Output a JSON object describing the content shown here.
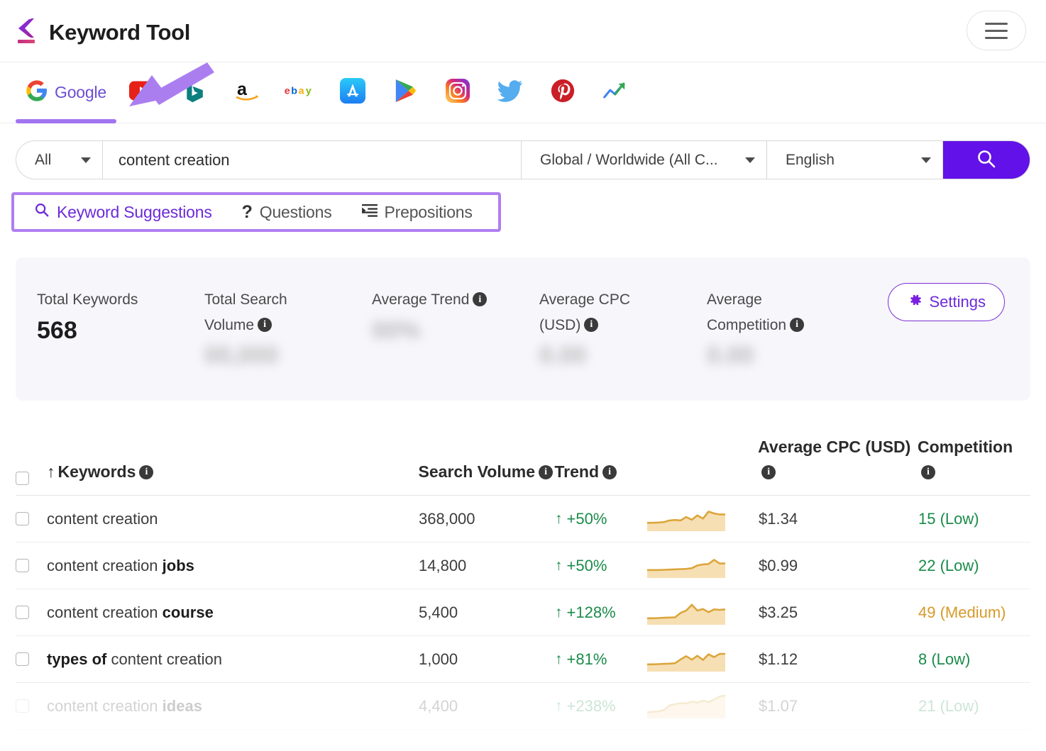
{
  "header": {
    "title": "Keyword Tool",
    "menu_icon": "hamburger-icon"
  },
  "platforms": [
    {
      "id": "google",
      "label": "Google",
      "icon": "google-icon",
      "active": true
    },
    {
      "id": "youtube",
      "label": "",
      "icon": "youtube-icon",
      "active": false
    },
    {
      "id": "bing",
      "label": "",
      "icon": "bing-icon",
      "active": false
    },
    {
      "id": "amazon",
      "label": "",
      "icon": "amazon-icon",
      "active": false
    },
    {
      "id": "ebay",
      "label": "",
      "icon": "ebay-icon",
      "active": false
    },
    {
      "id": "appstore",
      "label": "",
      "icon": "app-store-icon",
      "active": false
    },
    {
      "id": "playstore",
      "label": "",
      "icon": "play-store-icon",
      "active": false
    },
    {
      "id": "instagram",
      "label": "",
      "icon": "instagram-icon",
      "active": false
    },
    {
      "id": "twitter",
      "label": "",
      "icon": "twitter-icon",
      "active": false
    },
    {
      "id": "pinterest",
      "label": "",
      "icon": "pinterest-icon",
      "active": false
    },
    {
      "id": "trends",
      "label": "",
      "icon": "google-trends-icon",
      "active": false
    }
  ],
  "search": {
    "scope_value": "All",
    "query_value": "content creation",
    "query_placeholder": "content creation",
    "location_value": "Global / Worldwide (All C...",
    "language_value": "English",
    "search_icon": "search-icon"
  },
  "subtabs": [
    {
      "id": "keyword-suggestions",
      "label": "Keyword Suggestions",
      "icon": "magnifier-icon",
      "active": true
    },
    {
      "id": "questions",
      "label": "Questions",
      "icon": "question-mark-icon",
      "active": false
    },
    {
      "id": "prepositions",
      "label": "Prepositions",
      "icon": "list-indent-icon",
      "active": false
    }
  ],
  "stats": {
    "items": [
      {
        "label": "Total Keywords",
        "value": "568",
        "blurred": false,
        "has_info": false
      },
      {
        "label": "Total Search Volume",
        "value": "00,000",
        "blurred": true,
        "has_info": true
      },
      {
        "label": "Average Trend",
        "value": "00%",
        "blurred": true,
        "has_info": true
      },
      {
        "label": "Average CPC (USD)",
        "value": "0.00",
        "blurred": true,
        "has_info": true
      },
      {
        "label": "Average Competition",
        "value": "0.00",
        "blurred": true,
        "has_info": true
      }
    ],
    "settings_label": "Settings",
    "settings_icon": "gear-icon"
  },
  "table": {
    "columns": {
      "keywords": "Keywords",
      "search_volume": "Search Volume",
      "trend": "Trend",
      "avg_cpc": "Average CPC (USD)",
      "competition": "Competition"
    },
    "sort_indicator": "↑",
    "rows": [
      {
        "keyword_prefix": "content creation",
        "keyword_bold": "",
        "keyword_suffix": "",
        "volume": "368,000",
        "trend": "+50%",
        "cpc": "$1.34",
        "competition": "15 (Low)",
        "competition_level": "low",
        "spark": [
          0.3,
          0.3,
          0.31,
          0.33,
          0.4,
          0.42,
          0.4,
          0.55,
          0.43,
          0.62,
          0.48,
          0.78,
          0.7,
          0.66,
          0.66
        ]
      },
      {
        "keyword_prefix": "content creation ",
        "keyword_bold": "jobs",
        "keyword_suffix": "",
        "volume": "14,800",
        "trend": "+50%",
        "cpc": "$0.99",
        "competition": "22 (Low)",
        "competition_level": "low",
        "spark": [
          0.28,
          0.28,
          0.28,
          0.29,
          0.3,
          0.31,
          0.32,
          0.33,
          0.36,
          0.48,
          0.52,
          0.54,
          0.72,
          0.56,
          0.56
        ]
      },
      {
        "keyword_prefix": "content creation ",
        "keyword_bold": "course",
        "keyword_suffix": "",
        "volume": "5,400",
        "trend": "+128%",
        "cpc": "$3.25",
        "competition": "49 (Medium)",
        "competition_level": "medium",
        "spark": [
          0.22,
          0.22,
          0.23,
          0.24,
          0.25,
          0.26,
          0.45,
          0.55,
          0.8,
          0.55,
          0.62,
          0.48,
          0.6,
          0.58,
          0.6
        ]
      },
      {
        "keyword_prefix": "",
        "keyword_bold": "types of",
        "keyword_suffix": " content creation",
        "volume": "1,000",
        "trend": "+81%",
        "cpc": "$1.12",
        "competition": "8 (Low)",
        "competition_level": "low",
        "spark": [
          0.25,
          0.25,
          0.26,
          0.27,
          0.28,
          0.3,
          0.46,
          0.6,
          0.45,
          0.62,
          0.44,
          0.68,
          0.56,
          0.7,
          0.7
        ]
      },
      {
        "keyword_prefix": "content creation ",
        "keyword_bold": "ideas",
        "keyword_suffix": "",
        "volume": "4,400",
        "trend": "+238%",
        "cpc": "$1.07",
        "competition": "21 (Low)",
        "competition_level": "low",
        "spark": [
          0.2,
          0.22,
          0.24,
          0.3,
          0.5,
          0.55,
          0.6,
          0.58,
          0.66,
          0.62,
          0.7,
          0.64,
          0.74,
          0.88,
          0.92
        ]
      }
    ]
  },
  "annotation": {
    "arrow": "purple-arrow-pointing-to-google-tab",
    "highlight_box": "purple-box-around-subtabs"
  },
  "colors": {
    "brand_purple": "#6211e8",
    "accent_light_purple": "#a274f0",
    "annotation_purple": "#b07ef0",
    "green": "#1a8b4a",
    "amber": "#d79a28",
    "spark_line": "#dba63c",
    "spark_fill": "#f7dfb4"
  }
}
